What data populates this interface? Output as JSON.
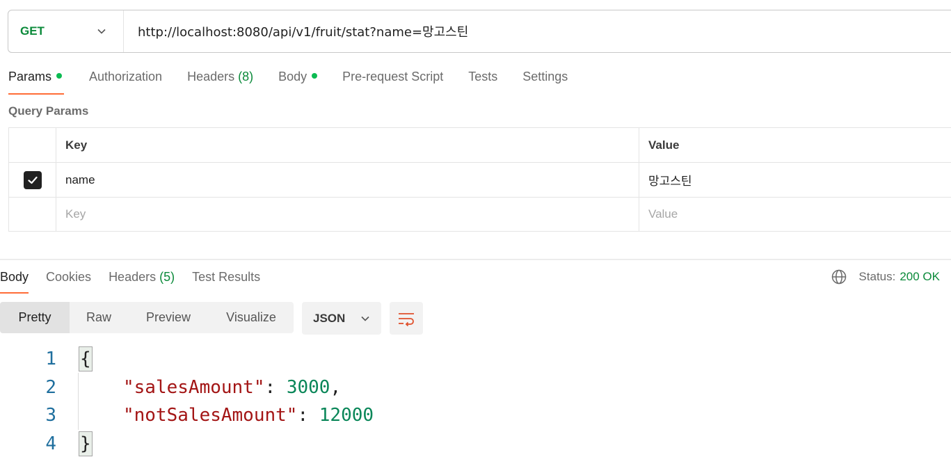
{
  "request": {
    "method": "GET",
    "url": "http://localhost:8080/api/v1/fruit/stat?name=망고스틴"
  },
  "request_tabs": [
    {
      "label": "Params",
      "count": "",
      "has_dot": true
    },
    {
      "label": "Authorization",
      "count": "",
      "has_dot": false
    },
    {
      "label": "Headers",
      "count": "(8)",
      "has_dot": false
    },
    {
      "label": "Body",
      "count": "",
      "has_dot": true
    },
    {
      "label": "Pre-request Script",
      "count": "",
      "has_dot": false
    },
    {
      "label": "Tests",
      "count": "",
      "has_dot": false
    },
    {
      "label": "Settings",
      "count": "",
      "has_dot": false
    }
  ],
  "query_params": {
    "title": "Query Params",
    "headers": {
      "key": "Key",
      "value": "Value"
    },
    "rows": [
      {
        "checked": true,
        "key": "name",
        "value": "망고스틴"
      }
    ],
    "placeholder": {
      "key": "Key",
      "value": "Value"
    }
  },
  "response_tabs": [
    {
      "label": "Body",
      "count": ""
    },
    {
      "label": "Cookies",
      "count": ""
    },
    {
      "label": "Headers",
      "count": "(5)"
    },
    {
      "label": "Test Results",
      "count": ""
    }
  ],
  "status": {
    "label": "Status:",
    "value": "200 OK"
  },
  "view_modes": [
    "Pretty",
    "Raw",
    "Preview",
    "Visualize"
  ],
  "format": "JSON",
  "body_lines": [
    {
      "n": "1",
      "open": "{"
    },
    {
      "n": "2",
      "key": "\"salesAmount\"",
      "sep": ": ",
      "val": "3000",
      "end": ","
    },
    {
      "n": "3",
      "key": "\"notSalesAmount\"",
      "sep": ": ",
      "val": "12000",
      "end": ""
    },
    {
      "n": "4",
      "close": "}"
    }
  ],
  "colors": {
    "accent": "#ff6c37",
    "success": "#0b8a3a",
    "dot": "#0cbb52",
    "json_key": "#a31515",
    "json_number": "#098658",
    "line_number": "#1f6f9e"
  }
}
